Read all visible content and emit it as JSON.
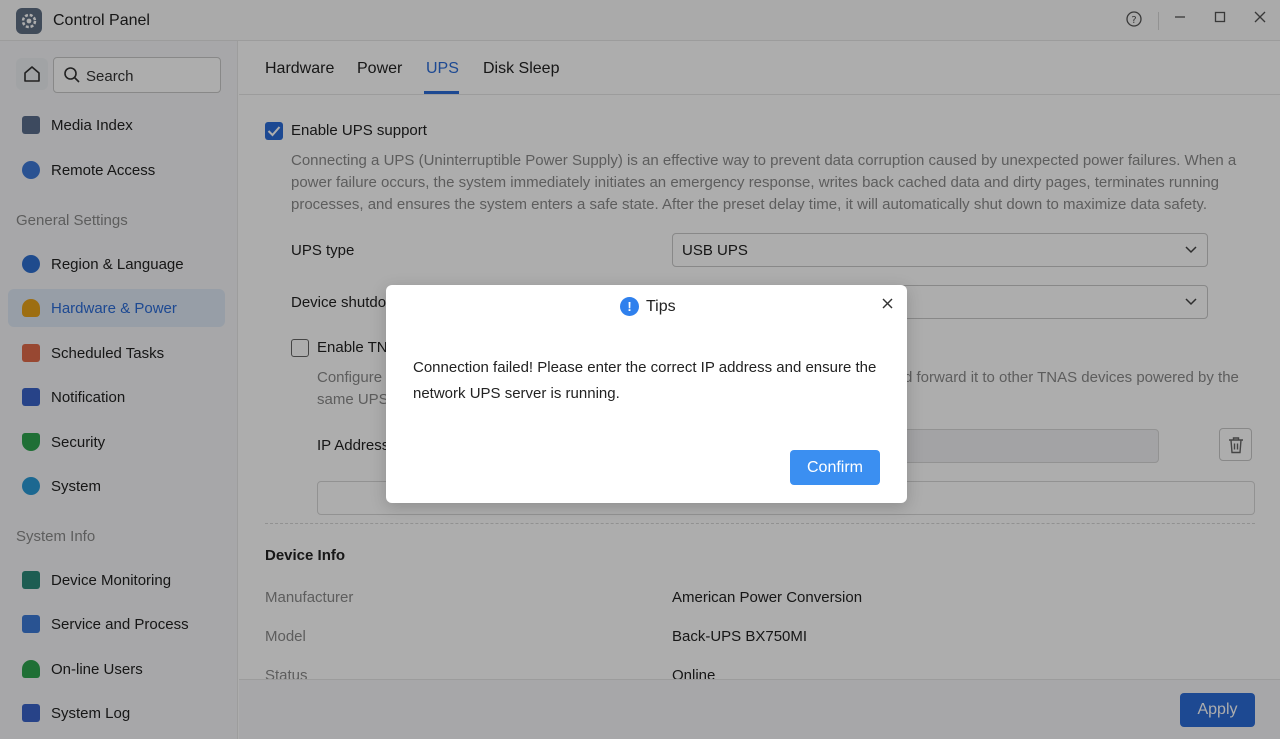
{
  "window": {
    "title": "Control Panel",
    "help_icon": "help-circle-icon",
    "minimize_icon": "minimize-icon",
    "maximize_icon": "maximize-icon",
    "close_icon": "close-icon"
  },
  "sidebar": {
    "search_placeholder": "Search",
    "items_top": [
      {
        "label": "Media Index",
        "icon": "media-index-icon",
        "color": "#5a6e8c"
      },
      {
        "label": "Remote Access",
        "icon": "cloud-icon",
        "color": "#3f7ad8"
      }
    ],
    "section_general": "General Settings",
    "items_general": [
      {
        "label": "Region & Language",
        "icon": "globe-icon",
        "color": "#2f6fd0"
      },
      {
        "label": "Hardware & Power",
        "icon": "bulb-icon",
        "color": "#e8a21a",
        "active": true
      },
      {
        "label": "Scheduled Tasks",
        "icon": "calendar-icon",
        "color": "#e06a4a"
      },
      {
        "label": "Notification",
        "icon": "notification-icon",
        "color": "#3a63c9"
      },
      {
        "label": "Security",
        "icon": "shield-icon",
        "color": "#2ea44f"
      },
      {
        "label": "System",
        "icon": "system-icon",
        "color": "#2a9ad6"
      }
    ],
    "section_info": "System Info",
    "items_info": [
      {
        "label": "Device Monitoring",
        "icon": "monitor-icon",
        "color": "#2b8a7a"
      },
      {
        "label": "Service and Process",
        "icon": "process-icon",
        "color": "#3d7bd8"
      },
      {
        "label": "On-line Users",
        "icon": "users-icon",
        "color": "#2ea44f"
      },
      {
        "label": "System Log",
        "icon": "log-icon",
        "color": "#3a63c9"
      }
    ]
  },
  "tabs": [
    "Hardware",
    "Power",
    "UPS",
    "Disk Sleep"
  ],
  "active_tab": "UPS",
  "ups": {
    "enable_label": "Enable UPS support",
    "enable_checked": true,
    "description": "Connecting a UPS (Uninterruptible Power Supply) is an effective way to prevent data corruption caused by unexpected power failures. When a power failure occurs, the system immediately initiates an emergency response, writes back cached data and dirty pages, terminates running processes, and ensures the system enters a safe state. After the preset delay time, it will automatically shut down to maximize data safety.",
    "type_label": "UPS type",
    "type_value": "USB UPS",
    "shutdown_label": "Device shutdo",
    "tnas_label": "Enable TN",
    "tnas_checked": false,
    "configure_desc_start": "Configure",
    "configure_desc_end": "d forward it to other TNAS devices powered by the",
    "configure_desc_line2": "same UPS",
    "ip_label": "IP Address"
  },
  "device_info": {
    "title": "Device Info",
    "rows": [
      {
        "key": "Manufacturer",
        "value": "American Power Conversion"
      },
      {
        "key": "Model",
        "value": "Back-UPS BX750MI"
      },
      {
        "key": "Status",
        "value": "Online"
      }
    ]
  },
  "footer": {
    "apply_label": "Apply"
  },
  "dialog": {
    "title": "Tips",
    "icon": "info-exclamation-icon",
    "message": "Connection failed! Please enter the correct IP address and ensure the network UPS server is running.",
    "confirm_label": "Confirm"
  },
  "colors": {
    "accent": "#2b6cd8",
    "confirm": "#3b8ff1"
  }
}
